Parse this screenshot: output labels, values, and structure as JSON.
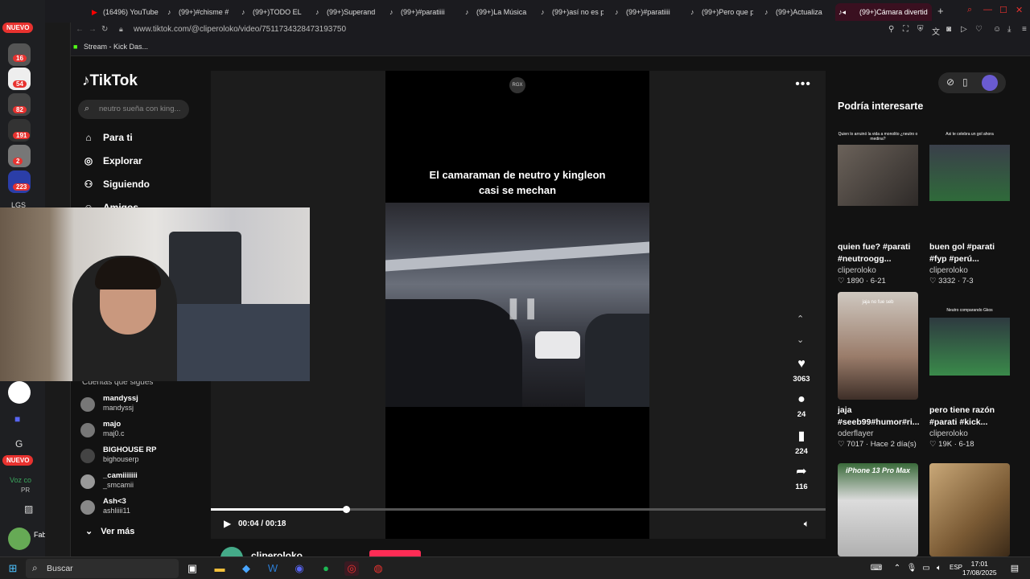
{
  "browser": {
    "tabs": [
      {
        "label": "(16496) YouTube",
        "icon": "youtube-icon",
        "color": "#ff0000"
      },
      {
        "label": "(99+)#chisme #",
        "icon": "tiktok-icon"
      },
      {
        "label": "(99+)TODO EL ",
        "icon": "tiktok-icon"
      },
      {
        "label": "(99+)Superand",
        "icon": "tiktok-icon"
      },
      {
        "label": "(99+)#paratiiii",
        "icon": "tiktok-icon"
      },
      {
        "label": "(99+)La Música",
        "icon": "tiktok-icon"
      },
      {
        "label": "(99+)así no es p",
        "icon": "tiktok-icon"
      },
      {
        "label": "(99+)#paratiiii",
        "icon": "tiktok-icon"
      },
      {
        "label": "(99+)Pero que p",
        "icon": "tiktok-icon"
      },
      {
        "label": "(99+)Actualiza",
        "icon": "tiktok-icon"
      },
      {
        "label": "(99+)Cámara divertid",
        "icon": "tiktok-icon",
        "active": true
      }
    ],
    "new_tab_label": "+",
    "url": "www.tiktok.com/@cliperoloko/video/7511734328473193750",
    "bookmark": "Stream - Kick Das..."
  },
  "discord": {
    "nuevo_top": "NUEVO",
    "nuevo_bottom": "NUEVO",
    "badges": [
      "16",
      "54",
      "82",
      "191",
      "2",
      "223"
    ],
    "lgs": "LGS",
    "g_label": "G",
    "voice_label": "Voz co",
    "voice_sub": "PR",
    "fab_label": "Fab",
    "gx": "GX"
  },
  "tiktok": {
    "logo": "TikTok",
    "search_placeholder": "neutro sueña con king...",
    "nav": [
      {
        "label": "Para ti",
        "icon": "home-icon"
      },
      {
        "label": "Explorar",
        "icon": "compass-icon"
      },
      {
        "label": "Siguiendo",
        "icon": "users-icon"
      },
      {
        "label": "Amigos",
        "icon": "friends-icon"
      }
    ],
    "following_title": "Cuentas que sigues",
    "accounts": [
      {
        "name": "mandyssj",
        "handle": "mandyssj"
      },
      {
        "name": "majo",
        "handle": "maj0.c"
      },
      {
        "name": "BIGHOUSE RP",
        "handle": "bighouserp"
      },
      {
        "name": "_camiiiiiii",
        "handle": "_smcamii"
      },
      {
        "name": "Ash<3",
        "handle": "ashliiii11"
      }
    ],
    "see_more": "Ver más"
  },
  "video": {
    "caption_line1": "El camaraman de neutro y kingleon",
    "caption_line2": "casi se mechan",
    "badge": "RGX",
    "time": "00:04 / 00:18",
    "progress": 0.22,
    "likes": "3063",
    "comments": "24",
    "saves": "224",
    "shares": "116",
    "author": "cliperoloko"
  },
  "recommendations": {
    "title": "Podría interesarte",
    "cards": [
      {
        "overlay": "Quien lo arruinó la vida a monolito ¿neutro o medina?",
        "title": "quien fue? #parati #neutroogg...",
        "user": "cliperoloko",
        "likes": "1890",
        "date": "6-21"
      },
      {
        "overlay": "Asi te celebra un gol ahora",
        "title": "buen gol #parati #fyp #perú...",
        "user": "cliperoloko",
        "likes": "3332",
        "date": "7-3"
      },
      {
        "overlay": "jaja no fue seb",
        "title": "jaja #seeb99#humor#ri...",
        "user": "oderflayer",
        "likes": "7017",
        "date": "Hace 2 día(s)"
      },
      {
        "overlay": "Neutro comparando Gkos",
        "title": "pero tiene razón #parati #kick...",
        "user": "cliperoloko",
        "likes": "19K",
        "date": "6-18"
      },
      {
        "overlay": "iPhone 13 Pro Max",
        "title": "",
        "user": "",
        "likes": "",
        "date": ""
      },
      {
        "overlay": "",
        "title": "",
        "user": "",
        "likes": "",
        "date": ""
      }
    ]
  },
  "taskbar": {
    "search_placeholder": "Buscar",
    "lang": "ESP",
    "time": "17:01",
    "date": "17/08/2025"
  }
}
